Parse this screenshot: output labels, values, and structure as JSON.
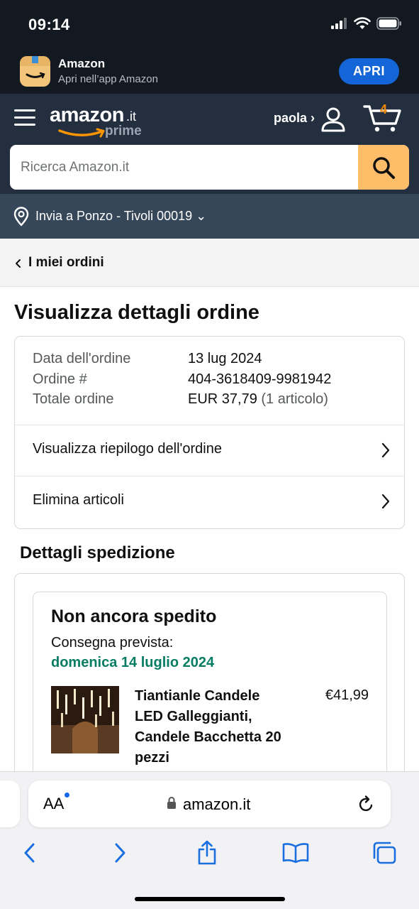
{
  "status_bar": {
    "time": "09:14"
  },
  "app_banner": {
    "title": "Amazon",
    "subtitle": "Apri nell’app Amazon",
    "open_button": "APRI"
  },
  "header": {
    "logo_main": "amazon",
    "logo_tld": ".it",
    "logo_prime": "prime",
    "account_label": "paola ›",
    "cart_count": "4",
    "search_placeholder": "Ricerca Amazon.it"
  },
  "deliver_to": {
    "text": "Invia a Ponzo - Tivoli 00019 ⌄"
  },
  "breadcrumb": {
    "label": "I miei ordini"
  },
  "page_title": "Visualizza dettagli ordine",
  "order": {
    "rows": [
      {
        "label": "Data dell'ordine",
        "value": "13 lug 2024",
        "extra": ""
      },
      {
        "label": "Ordine #",
        "value": "404-3618409-9981942",
        "extra": ""
      },
      {
        "label": "Totale ordine",
        "value": "EUR 37,79",
        "extra": " (1 articolo)"
      }
    ],
    "links": [
      {
        "label": "Visualizza riepilogo dell'ordine"
      },
      {
        "label": "Elimina articoli"
      }
    ]
  },
  "shipping": {
    "section_title": "Dettagli spedizione",
    "status": "Non ancora spedito",
    "expected_label": "Consegna prevista:",
    "expected_date": "domenica 14 luglio 2024",
    "item": {
      "name": "Tiantianle Candele LED Galleggianti, Candele Bacchetta 20 pezzi",
      "price": "€41,99"
    }
  },
  "browser": {
    "aa_label": "AA",
    "url": "amazon.it"
  },
  "colors": {
    "header_dark": "#131921",
    "nav": "#232f3e",
    "deliver_bar": "#37475a",
    "search_button": "#febd69",
    "cart_count": "#f08804",
    "delivery_green": "#067d62",
    "safari_blue": "#1a6fe0",
    "open_button": "#1466d8"
  },
  "icons": {
    "status": [
      "signal-icon",
      "wifi-icon",
      "battery-icon"
    ],
    "toolbar": [
      "back-icon",
      "forward-icon",
      "share-icon",
      "bookmarks-icon",
      "tabs-icon"
    ]
  }
}
